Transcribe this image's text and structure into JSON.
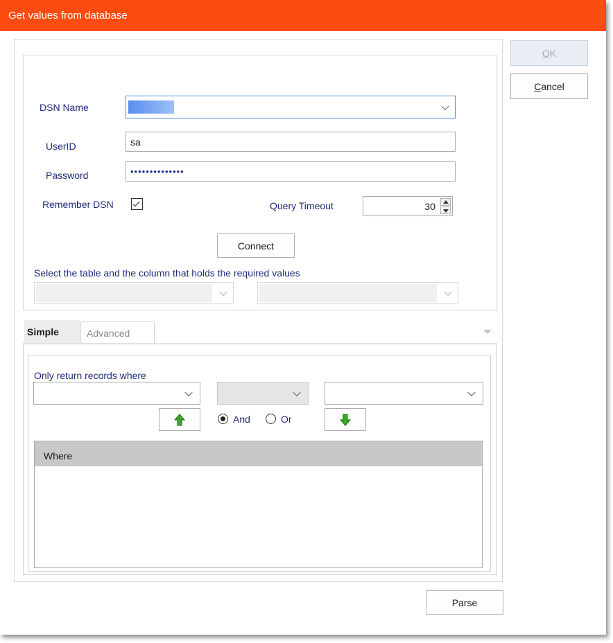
{
  "window": {
    "title": "Get values from database"
  },
  "buttons": {
    "ok": {
      "accel": "O",
      "rest": "K"
    },
    "cancel": {
      "accel": "C",
      "rest": "ancel"
    },
    "connect": "Connect",
    "parse": "Parse"
  },
  "connection": {
    "dsn_label": "DSN Name",
    "dsn_value": "",
    "userid_label": "UserID",
    "userid_value": "sa",
    "password_label": "Password",
    "password_value": "••••••••••••••",
    "remember_label": "Remember DSN",
    "remember_checked": true,
    "timeout_label": "Query Timeout",
    "timeout_value": "30"
  },
  "selection": {
    "instruction": "Select the table and the column that holds the required values",
    "table_value": "",
    "column_value": ""
  },
  "tabs": [
    {
      "label": "Simple",
      "active": true
    },
    {
      "label": "Advanced",
      "active": false
    }
  ],
  "filter": {
    "caption": "Only return records where",
    "field_value": "",
    "operator_value": "",
    "value_value": "",
    "and_label": "And",
    "or_label": "Or",
    "logic_selected": "And",
    "where_header": "Where",
    "where_rows": []
  },
  "colors": {
    "titlebar": "#fc4c10",
    "label_text": "#1f2a7a",
    "arrow_green": "#3aa829"
  },
  "icons": [
    "chevron-down-icon",
    "checkbox-checked-icon",
    "spin-up-icon",
    "spin-down-icon",
    "arrow-up-icon",
    "arrow-down-icon",
    "radio-checked-icon",
    "radio-unchecked-icon"
  ]
}
